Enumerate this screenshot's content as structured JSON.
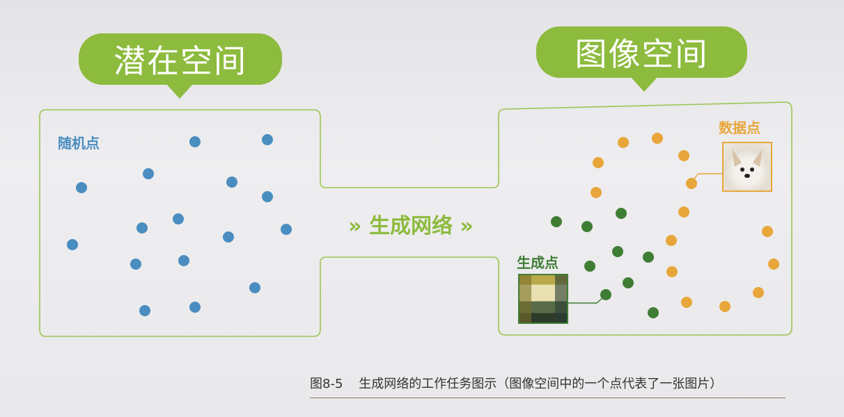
{
  "latent_space": {
    "title": "潜在空间",
    "points_label": "随机点"
  },
  "image_space": {
    "title": "图像空间",
    "data_points_label": "数据点",
    "generated_points_label": "生成点"
  },
  "network_label": "生成网络",
  "arrow_glyph": "»",
  "caption": {
    "figure_number": "图8-5",
    "text": "生成网络的工作任务图示（图像空间中的一个点代表了一张图片）"
  },
  "colors": {
    "green": "#8dbb3e",
    "blue": "#4a8dc0",
    "orange": "#e8a63a",
    "dark_green": "#3f7d35"
  }
}
